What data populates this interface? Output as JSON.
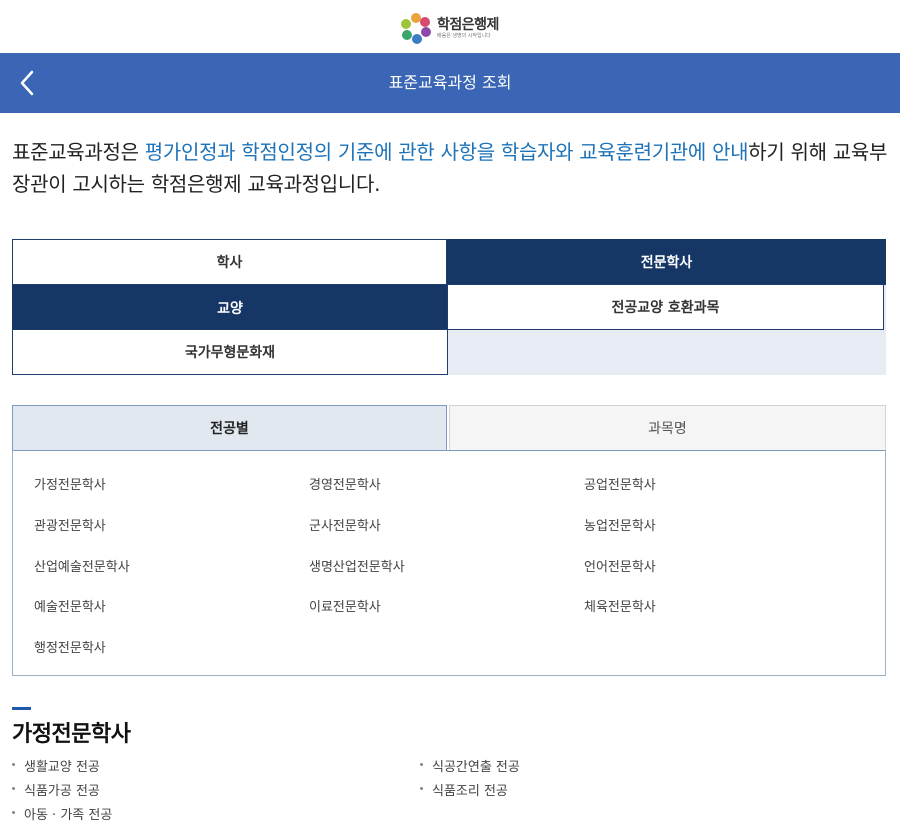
{
  "logo": {
    "name": "학점은행제",
    "tagline": "배움은 생명의 시작입니다"
  },
  "header": {
    "title": "표준교육과정 조회"
  },
  "intro": {
    "p1": "표준교육과정은 ",
    "h1": "평가인정과 학점인정의 기준에 관한 사항을 학습자와 교육훈련기관에 안내",
    "p2": "하기 위해 교육부장관이 고시하는 학점은행제 교육과정입니다."
  },
  "degree_tabs": [
    "학사",
    "전문학사",
    "교양",
    "전공교양 호환과목",
    "국가무형문화재"
  ],
  "search_tabs": {
    "by_major": "전공별",
    "by_subject": "과목명"
  },
  "majors": [
    "가정전문학사",
    "경영전문학사",
    "공업전문학사",
    "관광전문학사",
    "군사전문학사",
    "농업전문학사",
    "산업예술전문학사",
    "생명산업전문학사",
    "언어전문학사",
    "예술전문학사",
    "이료전문학사",
    "체육전문학사",
    "행정전문학사"
  ],
  "section": {
    "title": "가정전문학사",
    "items": [
      "생활교양 전공",
      "식공간연출 전공",
      "식품가공 전공",
      "식품조리 전공",
      "아동 · 가족 전공"
    ]
  },
  "colors": {
    "header": "#3a66b5",
    "tab_dark": "#163666",
    "highlight": "#1e73b8"
  }
}
